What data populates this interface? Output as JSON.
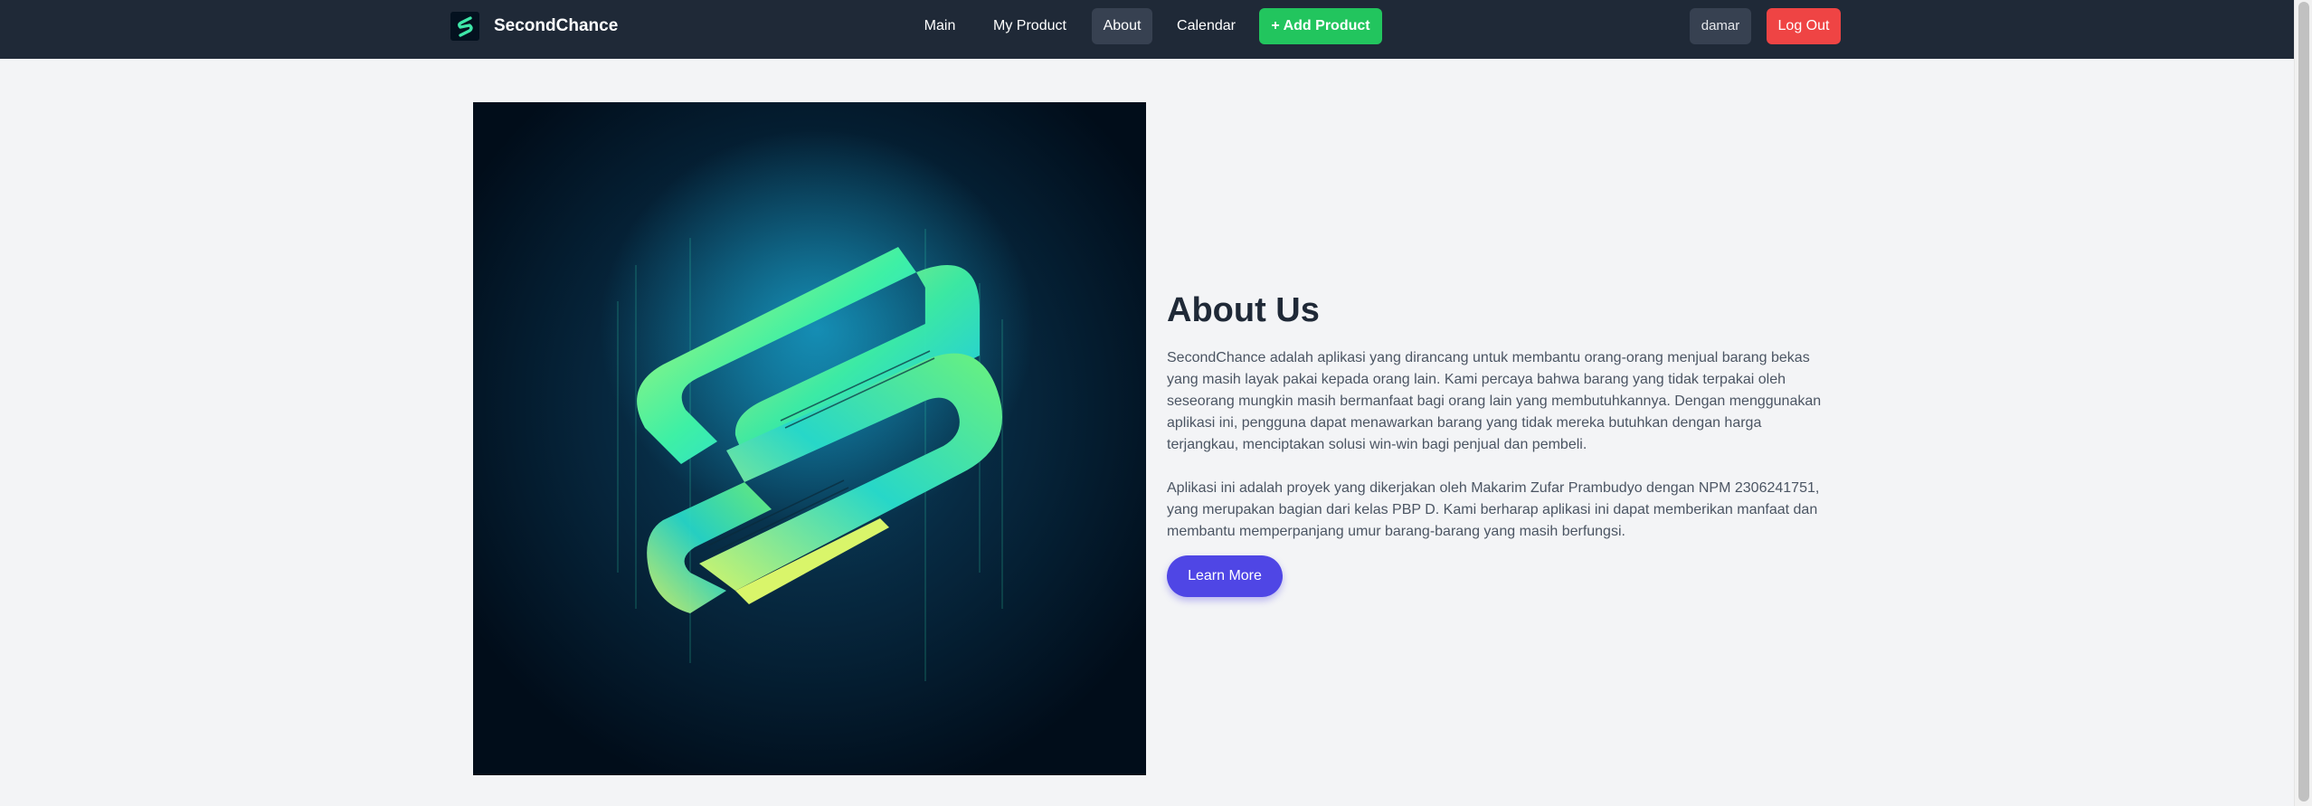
{
  "brand": {
    "name": "SecondChance",
    "logo_icon": "secondchance-s-logo"
  },
  "nav": {
    "links": [
      {
        "label": "Main",
        "active": false
      },
      {
        "label": "My Product",
        "active": false
      },
      {
        "label": "About",
        "active": true
      },
      {
        "label": "Calendar",
        "active": false
      }
    ],
    "add_product_label": "+ Add Product",
    "username": "damar",
    "logout_label": "Log Out"
  },
  "about": {
    "title": "About Us",
    "paragraph_1": "SecondChance adalah aplikasi yang dirancang untuk membantu orang-orang menjual barang bekas yang masih layak pakai kepada orang lain. Kami percaya bahwa barang yang tidak terpakai oleh seseorang mungkin masih bermanfaat bagi orang lain yang membutuhkannya. Dengan menggunakan aplikasi ini, pengguna dapat menawarkan barang yang tidak mereka butuhkan dengan harga terjangkau, menciptakan solusi win-win bagi penjual dan pembeli.",
    "paragraph_2": "Aplikasi ini adalah proyek yang dikerjakan oleh Makarim Zufar Prambudyo dengan NPM 2306241751, yang merupakan bagian dari kelas PBP D. Kami berharap aplikasi ini dapat memberikan manfaat dan membantu memperpanjang umur barang-barang yang masih berfungsi.",
    "button_label": "Learn More"
  },
  "colors": {
    "navbar_bg": "#1f2937",
    "page_bg": "#f3f4f6",
    "add_button": "#22c55e",
    "logout_button": "#ef4444",
    "learn_more_button": "#4f46e5"
  }
}
